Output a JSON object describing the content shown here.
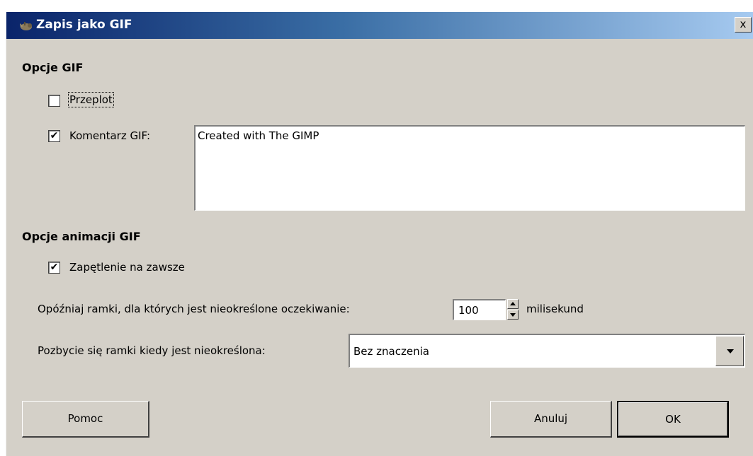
{
  "window": {
    "title": "Zapis jako GIF",
    "close_label": "x"
  },
  "gif_options": {
    "heading": "Opcje GIF",
    "interlace": {
      "label": "Przeplot",
      "checked": false
    },
    "comment": {
      "label": "Komentarz GIF:",
      "checked": true,
      "value": "Created with The GIMP"
    }
  },
  "animation_options": {
    "heading": "Opcje animacji GIF",
    "loop": {
      "label": "Zapętlenie na zawsze",
      "checked": true
    },
    "delay": {
      "label": "Opóźniaj ramki, dla których jest nieokreślone oczekiwanie:",
      "value": "100",
      "unit": "milisekund"
    },
    "disposal": {
      "label": "Pozbycie się ramki kiedy jest nieokreślona:",
      "selected": "Bez znaczenia"
    }
  },
  "buttons": {
    "help": "Pomoc",
    "cancel": "Anuluj",
    "ok": "OK"
  },
  "icons": {
    "title_icon": "gimp-wilber-icon",
    "check_glyph": "✔"
  }
}
